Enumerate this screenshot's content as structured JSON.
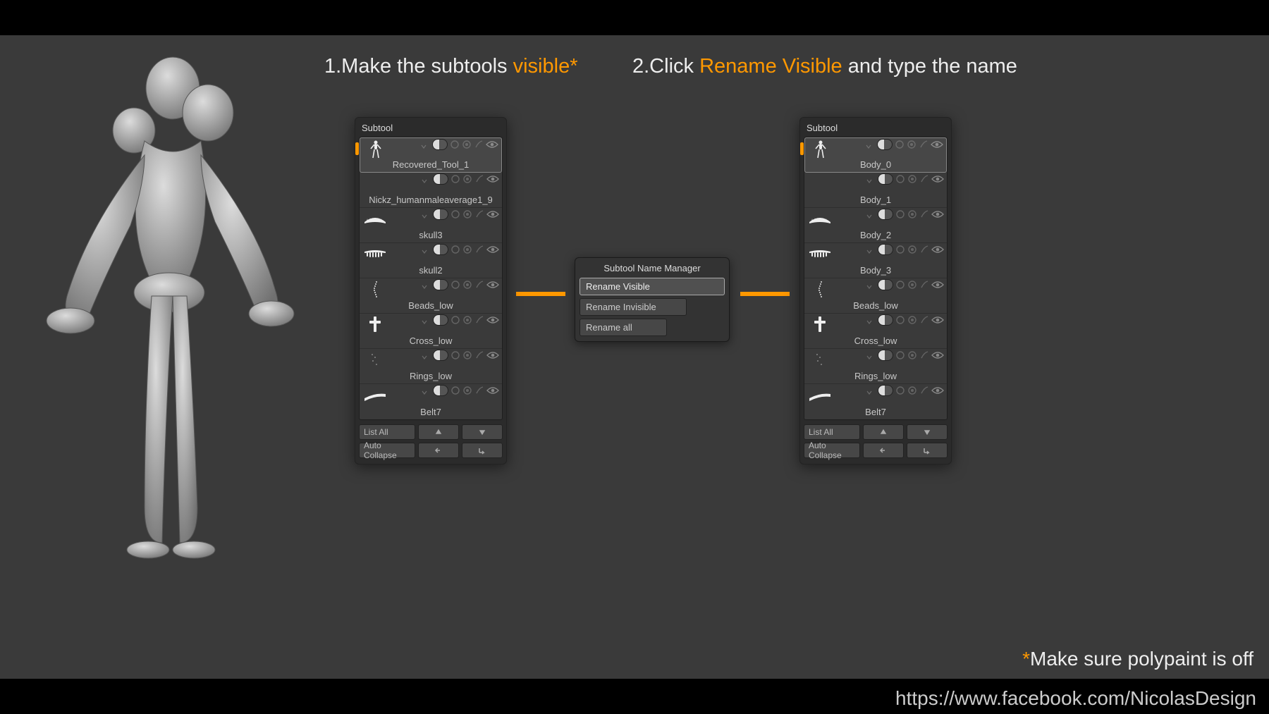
{
  "steps": {
    "one_a": "1.Make the subtools ",
    "one_b": "visible*",
    "two_a": "2.Click ",
    "two_b": "Rename Visible",
    "two_c": " and type the name"
  },
  "panel_title": "Subtool",
  "subtools_before": [
    "Recovered_Tool_1",
    "Nickz_humanmaleaverage1_9",
    "skull3",
    "skull2",
    "Beads_low",
    "Cross_low",
    "Rings_low",
    "Belt7"
  ],
  "subtools_after": [
    "Body_0",
    "Body_1",
    "Body_2",
    "Body_3",
    "Beads_low",
    "Cross_low",
    "Rings_low",
    "Belt7"
  ],
  "footer": {
    "list_all": "List All",
    "auto_collapse": "Auto Collapse"
  },
  "manager": {
    "title": "Subtool Name Manager",
    "b1": "Rename Visible",
    "b2": "Rename Invisible",
    "b3": "Rename all"
  },
  "footnote_a": "*",
  "footnote_b": "Make sure polypaint is off",
  "url": "https://www.facebook.com/NicolasDesign"
}
